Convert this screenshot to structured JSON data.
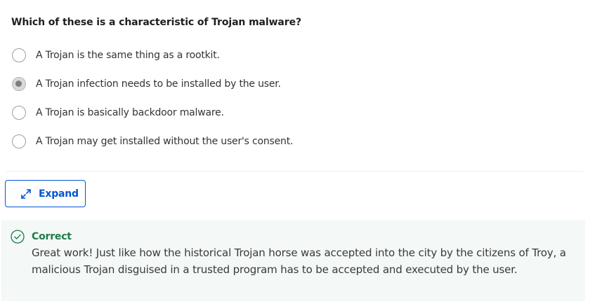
{
  "question": {
    "text": "Which of these is a characteristic of Trojan malware?"
  },
  "options": [
    {
      "label": "A Trojan is the same thing as a rootkit.",
      "selected": false
    },
    {
      "label": "A Trojan infection needs to be installed by the user.",
      "selected": true
    },
    {
      "label": "A Trojan is basically backdoor malware.",
      "selected": false
    },
    {
      "label": "A Trojan may get installed without the user's consent.",
      "selected": false
    }
  ],
  "expand_button": {
    "label": "Expand",
    "icon": "expand-arrows-icon"
  },
  "feedback": {
    "status": "Correct",
    "icon": "check-circle-icon",
    "message": "Great work! Just like how the historical Trojan horse was accepted into the city by the citizens of Troy, a malicious Trojan disguised in a trusted program has to be accepted and executed by the user."
  },
  "colors": {
    "accent": "#0056d2",
    "correct": "#1e7a4a",
    "feedback_bg": "#f4f8f6"
  }
}
